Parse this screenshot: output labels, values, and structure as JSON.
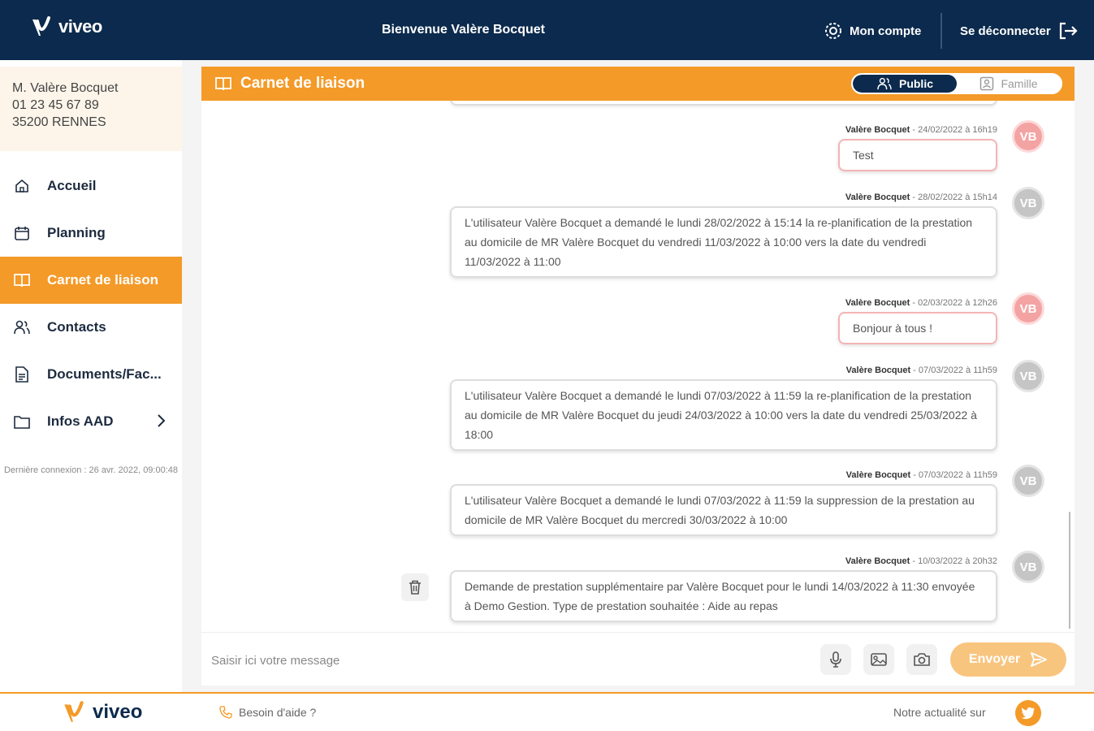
{
  "header": {
    "brand": "viveo",
    "welcome": "Bienvenue Valère Bocquet",
    "account_label": "Mon compte",
    "logout_label": "Se déconnecter"
  },
  "user": {
    "name": "M. Valère Bocquet",
    "phone": "01 23 45 67 89",
    "city": "35200 RENNES"
  },
  "sidebar": {
    "items": [
      {
        "label": "Accueil",
        "icon": "home-icon"
      },
      {
        "label": "Planning",
        "icon": "calendar-icon"
      },
      {
        "label": "Carnet de liaison",
        "icon": "book-icon",
        "active": true
      },
      {
        "label": "Contacts",
        "icon": "users-icon"
      },
      {
        "label": "Documents/Fac...",
        "icon": "document-icon"
      },
      {
        "label": "Infos AAD",
        "icon": "folder-icon"
      }
    ],
    "last_connection": "Dernière connexion : 26 avr. 2022, 09:00:48"
  },
  "panel": {
    "title": "Carnet de liaison",
    "toggle": {
      "public_label": "Public",
      "family_label": "Famille",
      "selected": "Public"
    }
  },
  "messages": [
    {
      "author": "Valère Bocquet",
      "date": " - 24/02/2022 à 16h19",
      "text": "Test",
      "avatar": "VB",
      "style": "pink"
    },
    {
      "author": "Valère Bocquet",
      "date": " - 28/02/2022 à 15h14",
      "text": "L'utilisateur Valère Bocquet a demandé le lundi 28/02/2022 à 15:14 la re-planification de la prestation au domicile de MR Valère Bocquet du vendredi 11/03/2022 à 10:00 vers la date du vendredi 11/03/2022 à 11:00",
      "avatar": "VB",
      "style": "grey"
    },
    {
      "author": "Valère Bocquet",
      "date": " - 02/03/2022 à 12h26",
      "text": "Bonjour à tous !",
      "avatar": "VB",
      "style": "pink"
    },
    {
      "author": "Valère Bocquet",
      "date": " - 07/03/2022 à 11h59",
      "text": "L'utilisateur Valère Bocquet a demandé le lundi 07/03/2022 à 11:59 la re-planification de la prestation au domicile de MR Valère Bocquet du jeudi 24/03/2022 à 10:00 vers la date du vendredi 25/03/2022 à 18:00",
      "avatar": "VB",
      "style": "grey"
    },
    {
      "author": "Valère Bocquet",
      "date": " - 07/03/2022 à 11h59",
      "text": "L'utilisateur Valère Bocquet a demandé le lundi 07/03/2022 à 11:59 la suppression de la prestation au domicile de MR Valère Bocquet du mercredi 30/03/2022 à 10:00",
      "avatar": "VB",
      "style": "grey"
    },
    {
      "author": "Valère Bocquet",
      "date": " - 10/03/2022 à 20h32",
      "text": "Demande de prestation supplémentaire par Valère Bocquet pour le lundi 14/03/2022 à 11:30 envoyée à Demo Gestion. Type de prestation souhaitée : Aide au repas",
      "avatar": "VB",
      "style": "grey"
    }
  ],
  "composer": {
    "placeholder": "Saisir ici votre message",
    "value": "",
    "send_label": "Envoyer"
  },
  "footer": {
    "brand": "viveo",
    "help_label": "Besoin d'aide ?",
    "news_label": "Notre actualité sur"
  },
  "colors": {
    "navy": "#0b2a4d",
    "orange": "#f49a28",
    "pink_avatar": "#f4a3a3",
    "grey_avatar": "#c5c5c5"
  }
}
